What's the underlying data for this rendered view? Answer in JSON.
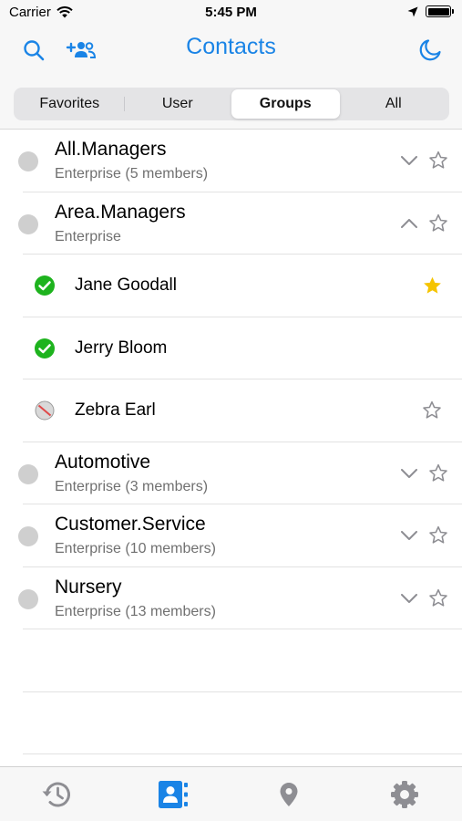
{
  "status_bar": {
    "carrier": "Carrier",
    "time": "5:45 PM"
  },
  "nav": {
    "title": "Contacts"
  },
  "segments": [
    {
      "label": "Favorites",
      "active": false
    },
    {
      "label": "User",
      "active": false
    },
    {
      "label": "Groups",
      "active": true
    },
    {
      "label": "All",
      "active": false
    }
  ],
  "groups": [
    {
      "name": "All.Managers",
      "subtitle": "Enterprise (5 members)",
      "expanded": false,
      "favorite": false
    },
    {
      "name": "Area.Managers",
      "subtitle": "Enterprise",
      "expanded": true,
      "favorite": false,
      "members": [
        {
          "name": "Jane Goodall",
          "status": "available",
          "favorite": true
        },
        {
          "name": "Jerry Bloom",
          "status": "available",
          "favorite": null
        },
        {
          "name": "Zebra Earl",
          "status": "offline",
          "favorite": false
        }
      ]
    },
    {
      "name": "Automotive",
      "subtitle": "Enterprise (3 members)",
      "expanded": false,
      "favorite": false
    },
    {
      "name": "Customer.Service",
      "subtitle": "Enterprise (10 members)",
      "expanded": false,
      "favorite": false
    },
    {
      "name": "Nursery",
      "subtitle": "Enterprise (13 members)",
      "expanded": false,
      "favorite": false
    }
  ],
  "tabs": [
    {
      "icon": "history-icon",
      "active": false
    },
    {
      "icon": "contacts-icon",
      "active": true
    },
    {
      "icon": "location-pin-icon",
      "active": false
    },
    {
      "icon": "settings-gear-icon",
      "active": false
    }
  ],
  "colors": {
    "accent": "#1a84e6",
    "available": "#1eb31e",
    "star_filled": "#f5c400",
    "inactive_icon": "#8e8e93"
  }
}
